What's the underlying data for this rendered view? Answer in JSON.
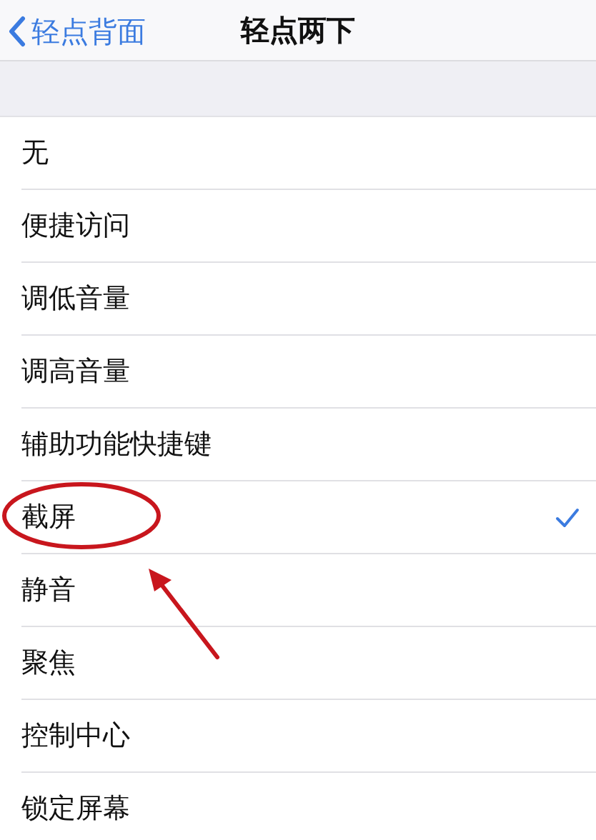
{
  "nav": {
    "back_label": "轻点背面",
    "title": "轻点两下"
  },
  "options": [
    {
      "label": "无",
      "selected": false
    },
    {
      "label": "便捷访问",
      "selected": false
    },
    {
      "label": "调低音量",
      "selected": false
    },
    {
      "label": "调高音量",
      "selected": false
    },
    {
      "label": "辅助功能快捷键",
      "selected": false
    },
    {
      "label": "截屏",
      "selected": true
    },
    {
      "label": "静音",
      "selected": false
    },
    {
      "label": "聚焦",
      "selected": false
    },
    {
      "label": "控制中心",
      "selected": false
    },
    {
      "label": "锁定屏幕",
      "selected": false
    }
  ]
}
